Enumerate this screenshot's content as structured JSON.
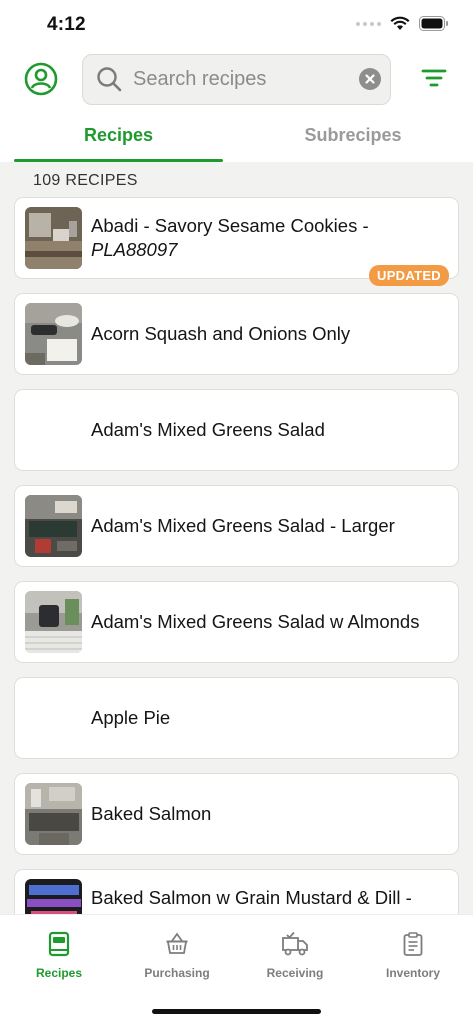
{
  "status_bar": {
    "time": "4:12"
  },
  "header": {
    "search_placeholder": "Search recipes",
    "profile_icon": "person-circle-icon",
    "filter_icon": "filter-icon"
  },
  "tabs": [
    {
      "label": "Recipes",
      "active": true
    },
    {
      "label": "Subrecipes",
      "active": false
    }
  ],
  "recipe_count": "109 RECIPES",
  "recipes": [
    {
      "title": "Abadi - Savory Sesame Cookies  -",
      "code": "PLA88097",
      "badge": "UPDATED",
      "has_photo": true
    },
    {
      "title": "Acorn Squash and Onions Only",
      "has_photo": true
    },
    {
      "title": "Adam's Mixed Greens Salad",
      "has_photo": false
    },
    {
      "title": "Adam's Mixed Greens Salad - Larger",
      "has_photo": true
    },
    {
      "title": "Adam's Mixed Greens Salad w Almonds",
      "has_photo": true
    },
    {
      "title": "Apple Pie",
      "has_photo": false
    },
    {
      "title": "Baked Salmon",
      "has_photo": true
    },
    {
      "title": "Baked Salmon w Grain Mustard & Dill  -",
      "has_photo": true
    }
  ],
  "bottom_nav": [
    {
      "label": "Recipes",
      "icon": "book-icon",
      "active": true
    },
    {
      "label": "Purchasing",
      "icon": "basket-icon",
      "active": false
    },
    {
      "label": "Receiving",
      "icon": "truck-icon",
      "active": false
    },
    {
      "label": "Inventory",
      "icon": "clipboard-icon",
      "active": false
    }
  ],
  "colors": {
    "accent": "#1f9a2f",
    "badge": "#f39b44",
    "background": "#f2f3f1"
  }
}
